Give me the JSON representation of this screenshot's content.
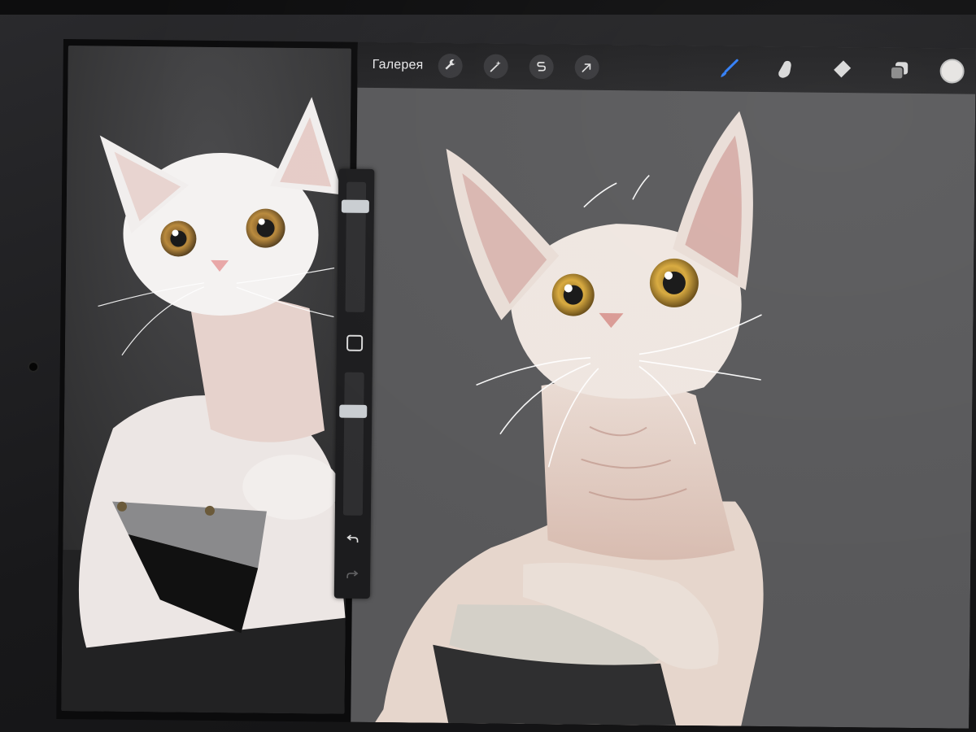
{
  "toolbar": {
    "gallery_label": "Галерея",
    "left_tools": [
      {
        "name": "actions",
        "icon": "wrench-icon"
      },
      {
        "name": "adjustments",
        "icon": "magic-wand-icon"
      },
      {
        "name": "selection",
        "icon": "selection-s-icon"
      },
      {
        "name": "transform",
        "icon": "arrow-cursor-icon"
      }
    ],
    "right_tools": [
      {
        "name": "brush",
        "icon": "brush-icon",
        "active": true
      },
      {
        "name": "smudge",
        "icon": "smudge-finger-icon"
      },
      {
        "name": "eraser",
        "icon": "eraser-icon"
      },
      {
        "name": "layers",
        "icon": "layers-icon"
      }
    ],
    "current_color": "#e6e4e2"
  },
  "sidebar": {
    "brush_size_level": 0.15,
    "opacity_level": 0.75,
    "modify_icon": "square-icon",
    "undo_icon": "undo-icon",
    "redo_icon": "redo-icon"
  },
  "colors": {
    "accent": "#2f7cf6",
    "canvas_bg": "#58585a",
    "toolbar_bg": "#222224"
  }
}
